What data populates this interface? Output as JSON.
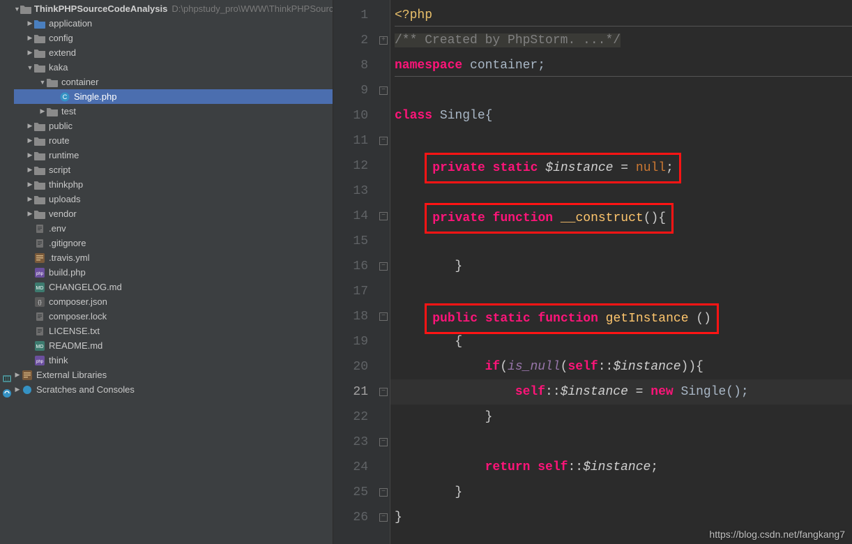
{
  "project": {
    "root": {
      "name": "ThinkPHPSourceCodeAnalysis",
      "path": "D:\\phpstudy_pro\\WWW\\ThinkPHPSourceCo"
    },
    "tree": [
      {
        "depth": 1,
        "arrow": "right",
        "icon": "folder-blue",
        "label": "application"
      },
      {
        "depth": 1,
        "arrow": "right",
        "icon": "folder",
        "label": "config"
      },
      {
        "depth": 1,
        "arrow": "right",
        "icon": "folder",
        "label": "extend"
      },
      {
        "depth": 1,
        "arrow": "down",
        "icon": "folder",
        "label": "kaka"
      },
      {
        "depth": 2,
        "arrow": "down",
        "icon": "folder",
        "label": "container"
      },
      {
        "depth": 3,
        "arrow": "blank",
        "icon": "php-class",
        "label": "Single.php",
        "selected": true
      },
      {
        "depth": 2,
        "arrow": "right",
        "icon": "folder",
        "label": "test"
      },
      {
        "depth": 1,
        "arrow": "right",
        "icon": "folder",
        "label": "public"
      },
      {
        "depth": 1,
        "arrow": "right",
        "icon": "folder",
        "label": "route"
      },
      {
        "depth": 1,
        "arrow": "right",
        "icon": "folder",
        "label": "runtime"
      },
      {
        "depth": 1,
        "arrow": "right",
        "icon": "folder",
        "label": "script"
      },
      {
        "depth": 1,
        "arrow": "right",
        "icon": "folder",
        "label": "thinkphp"
      },
      {
        "depth": 1,
        "arrow": "right",
        "icon": "folder",
        "label": "uploads"
      },
      {
        "depth": 1,
        "arrow": "right",
        "icon": "folder",
        "label": "vendor"
      },
      {
        "depth": 1,
        "arrow": "blank",
        "icon": "file",
        "label": ".env"
      },
      {
        "depth": 1,
        "arrow": "blank",
        "icon": "file",
        "label": ".gitignore"
      },
      {
        "depth": 1,
        "arrow": "blank",
        "icon": "yml",
        "label": ".travis.yml"
      },
      {
        "depth": 1,
        "arrow": "blank",
        "icon": "php",
        "label": "build.php"
      },
      {
        "depth": 1,
        "arrow": "blank",
        "icon": "md",
        "label": "CHANGELOG.md"
      },
      {
        "depth": 1,
        "arrow": "blank",
        "icon": "json",
        "label": "composer.json"
      },
      {
        "depth": 1,
        "arrow": "blank",
        "icon": "file",
        "label": "composer.lock"
      },
      {
        "depth": 1,
        "arrow": "blank",
        "icon": "file",
        "label": "LICENSE.txt"
      },
      {
        "depth": 1,
        "arrow": "blank",
        "icon": "md",
        "label": "README.md"
      },
      {
        "depth": 1,
        "arrow": "blank",
        "icon": "php",
        "label": "think"
      }
    ],
    "extLibs": "External Libraries",
    "scratches": "Scratches and Consoles"
  },
  "editor": {
    "numbers": [
      "1",
      "2",
      "8",
      "9",
      "10",
      "11",
      "12",
      "13",
      "14",
      "15",
      "16",
      "17",
      "18",
      "19",
      "20",
      "21",
      "22",
      "23",
      "24",
      "25",
      "26"
    ],
    "currentIndex": 15,
    "foldMarks": {
      "1": "+",
      "3": "−",
      "5": "−",
      "8": "−",
      "10": "−",
      "12": "−",
      "15": "−",
      "17": "−",
      "19": "−",
      "20": "−"
    },
    "lines": {
      "l1": "<?php",
      "l2": "/** Created by PhpStorm. ...*/",
      "l8a": "namespace",
      "l8b": " container;",
      "l10a": "class",
      "l10b": " Single{",
      "l12_priv": "private",
      "l12_stat": " static ",
      "l12_var": "$instance",
      "l12_eq": " = ",
      "l12_null": "null",
      "l12_sc": ";",
      "l14_priv": "private",
      "l14_fn": " function ",
      "l14_name": "__construct",
      "l14_tail": "(){",
      "l16": "        }",
      "l18_pub": "public",
      "l18_stat": " static ",
      "l18_fn": "function ",
      "l18_name": "getInstance",
      "l18_tail": " ()",
      "l19": "        {",
      "l20_if": "if",
      "l20_a": "(",
      "l20_isnull": "is_null",
      "l20_b": "(",
      "l20_self": "self",
      "l20_cc": "::",
      "l20_var": "$instance",
      "l20_tail": ")){",
      "l21_self": "self",
      "l21_cc": "::",
      "l21_var": "$instance",
      "l21_eq": " = ",
      "l21_new": "new",
      "l21_cls": " Single();",
      "l22": "            }",
      "l24_ret": "return",
      "l24_sp": " ",
      "l24_self": "self",
      "l24_cc": "::",
      "l24_var": "$instance",
      "l24_sc": ";",
      "l25": "        }",
      "l26": "}"
    }
  },
  "watermark": "https://blog.csdn.net/fangkang7"
}
